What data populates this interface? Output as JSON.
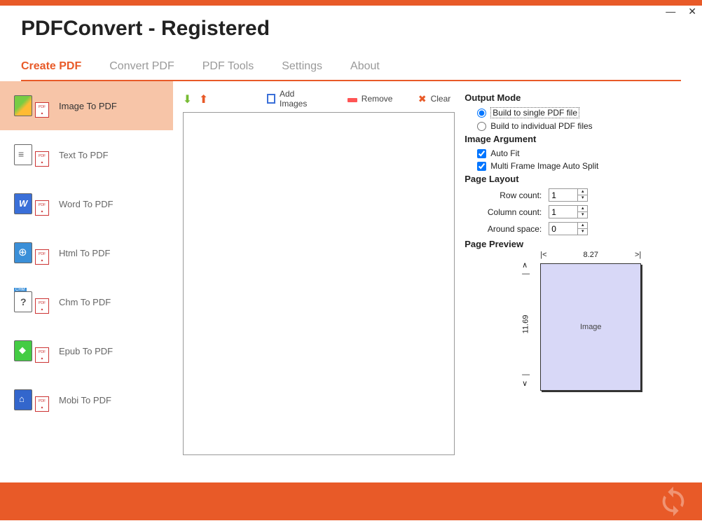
{
  "window": {
    "title": "PDFConvert - Registered"
  },
  "tabs": [
    {
      "label": "Create PDF",
      "active": true
    },
    {
      "label": "Convert PDF"
    },
    {
      "label": "PDF Tools"
    },
    {
      "label": "Settings"
    },
    {
      "label": "About"
    }
  ],
  "sidebar": {
    "items": [
      {
        "label": "Image To PDF",
        "active": true
      },
      {
        "label": "Text To PDF"
      },
      {
        "label": "Word To PDF"
      },
      {
        "label": "Html To PDF"
      },
      {
        "label": "Chm To PDF"
      },
      {
        "label": "Epub To PDF"
      },
      {
        "label": "Mobi To PDF"
      }
    ]
  },
  "toolbar": {
    "add_images": "Add Images",
    "remove": "Remove",
    "clear": "Clear"
  },
  "output_mode": {
    "title": "Output Mode",
    "single": "Build to single PDF file",
    "individual": "Build to individual PDF files",
    "selected": "single"
  },
  "image_argument": {
    "title": "Image Argument",
    "auto_fit": {
      "label": "Auto Fit",
      "checked": true
    },
    "multi_frame": {
      "label": "Multi Frame Image Auto Split",
      "checked": true
    }
  },
  "page_layout": {
    "title": "Page Layout",
    "row_count": {
      "label": "Row count:",
      "value": "1"
    },
    "column_count": {
      "label": "Column count:",
      "value": "1"
    },
    "around_space": {
      "label": "Around space:",
      "value": "0"
    }
  },
  "page_preview": {
    "title": "Page Preview",
    "width": "8.27",
    "height": "11.69",
    "content_label": "Image"
  }
}
